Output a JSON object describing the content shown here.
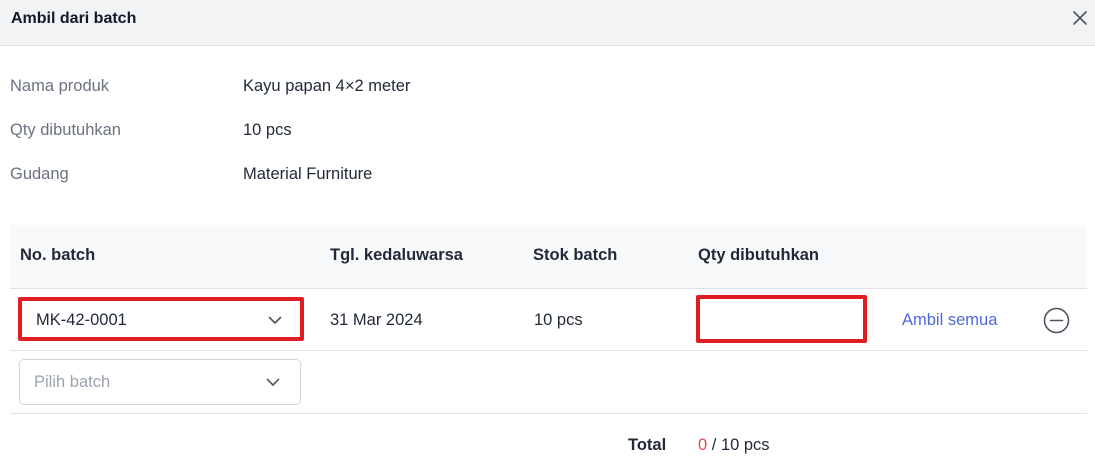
{
  "modal": {
    "title": "Ambil dari batch",
    "close_icon": "close-icon"
  },
  "info": {
    "product_label": "Nama produk",
    "product_value": "Kayu papan 4×2 meter",
    "qty_label": "Qty dibutuhkan",
    "qty_value": "10 pcs",
    "warehouse_label": "Gudang",
    "warehouse_value": "Material Furniture"
  },
  "table": {
    "headers": {
      "batch": "No. batch",
      "expiry": "Tgl. kedaluwarsa",
      "stock": "Stok batch",
      "qty": "Qty dibutuhkan"
    },
    "rows": [
      {
        "batch": "MK-42-0001",
        "expiry": "31 Mar 2024",
        "stock": "10 pcs",
        "qty_value": "",
        "take_all_label": "Ambil semua",
        "remove_icon": "minus-circle-icon"
      }
    ],
    "new_row": {
      "placeholder": "Pilih batch"
    }
  },
  "total": {
    "label": "Total",
    "current": "0",
    "rest": " / 10 pcs"
  },
  "colors": {
    "highlight": "#e11d24",
    "link": "#4f6ad7",
    "total_current": "#e5484d"
  }
}
